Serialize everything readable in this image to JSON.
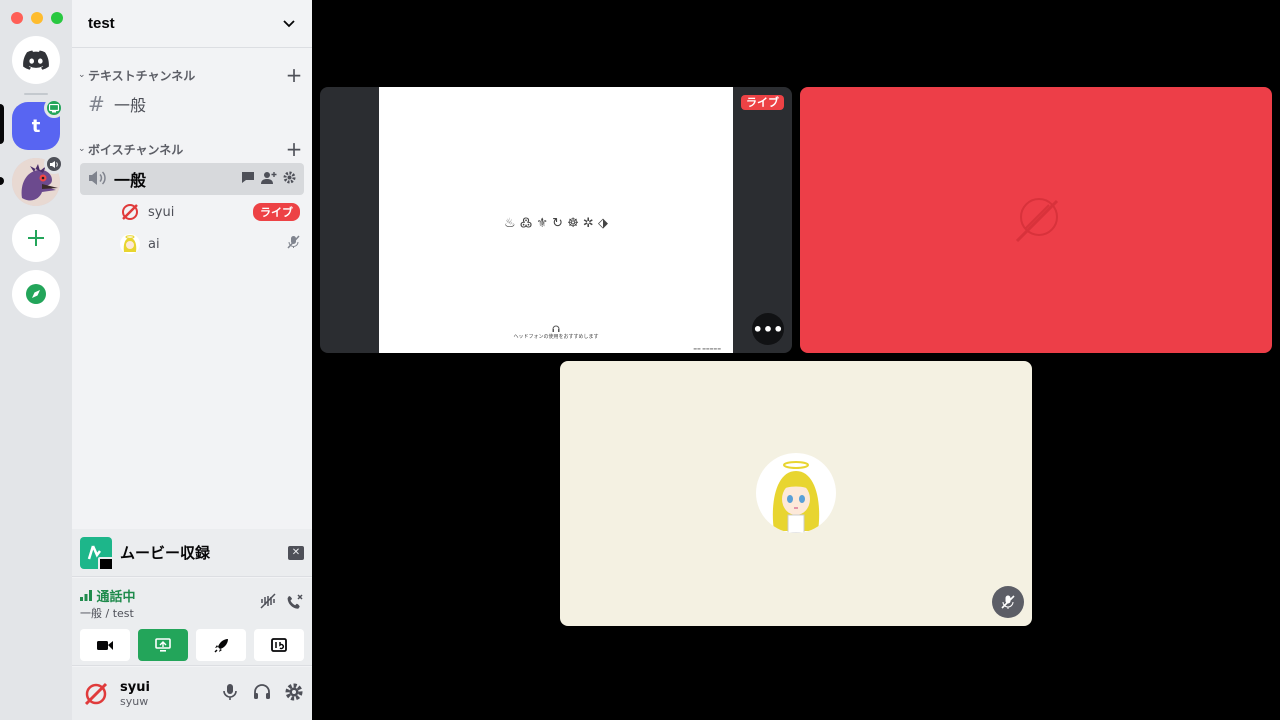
{
  "window": {
    "title": "test"
  },
  "guild": {
    "name": "test"
  },
  "categories": {
    "text": {
      "label": "テキストチャンネル"
    },
    "voice": {
      "label": "ボイスチャンネル"
    }
  },
  "text_channel": {
    "name": "一般"
  },
  "voice_channel": {
    "name": "一般",
    "users": [
      {
        "name": "syui",
        "badge": "ライブ"
      },
      {
        "name": "ai"
      }
    ]
  },
  "activity": {
    "name": "ムービー収録"
  },
  "voice_status": {
    "status": "通話中",
    "location": "一般 / test"
  },
  "user": {
    "name": "syui",
    "tag": "syuw"
  },
  "stage": {
    "stream_live": "ライブ",
    "stream_glyphs": "♨ ߷ ⚜ ↻ ☸ ✲ ⬗",
    "stream_note": "ヘッドフォンの使用をおすすめします"
  },
  "colors": {
    "accent": "#5865f2",
    "live": "#ed4245",
    "connected": "#23a55a",
    "red_tile": "#ed3e48",
    "cream_tile": "#f4f1e2"
  }
}
